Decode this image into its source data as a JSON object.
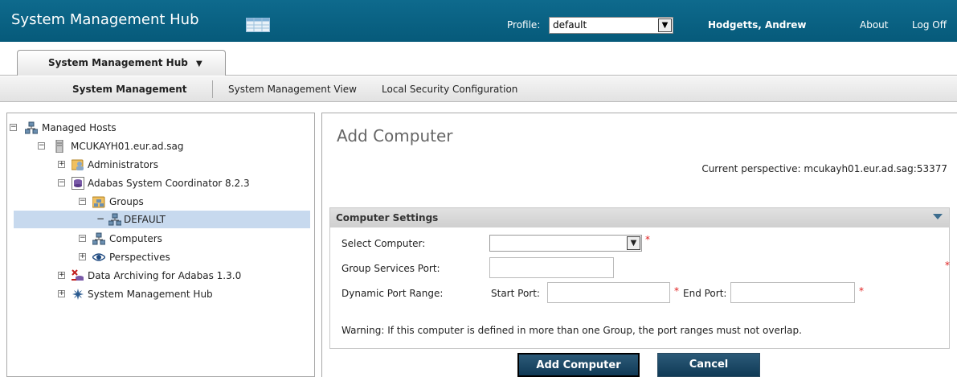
{
  "header": {
    "app_title": "System Management Hub",
    "profile_label": "Profile:",
    "profile_value": "default",
    "user_name": "Hodgetts, Andrew",
    "about": "About",
    "logoff": "Log Off"
  },
  "tabs": {
    "hub_tab": "System Management Hub"
  },
  "subnav": {
    "items": [
      "System Management",
      "System Management View",
      "Local Security Configuration"
    ]
  },
  "tree": {
    "nodes": [
      {
        "label": "Managed Hosts",
        "expander": "−",
        "icon": "network-icon"
      },
      {
        "label": "MCUKAYH01.eur.ad.sag",
        "expander": "−",
        "icon": "server-icon"
      },
      {
        "label": "Administrators",
        "expander": "+",
        "icon": "users-icon"
      },
      {
        "label": "Adabas System Coordinator 8.2.3",
        "expander": "−",
        "icon": "database-icon"
      },
      {
        "label": "Groups",
        "expander": "−",
        "icon": "group-folder-icon"
      },
      {
        "label": "DEFAULT",
        "expander": "−",
        "icon": "network-icon"
      },
      {
        "label": "Computers",
        "expander": "−",
        "icon": "network-icon"
      },
      {
        "label": "Perspectives",
        "expander": "+",
        "icon": "eye-icon"
      },
      {
        "label": "Data Archiving for Adabas 1.3.0",
        "expander": "+",
        "icon": "archive-icon"
      },
      {
        "label": "System Management Hub",
        "expander": "+",
        "icon": "hub-icon"
      }
    ]
  },
  "content": {
    "title": "Add Computer",
    "perspective": "Current perspective: mcukayh01.eur.ad.sag:53377",
    "section_title": "Computer Settings",
    "select_computer_label": "Select Computer:",
    "group_services_port_label": "Group Services Port:",
    "dynamic_port_range_label": "Dynamic Port Range:",
    "start_port_label": "Start Port:",
    "end_port_label": "End Port:",
    "required_mark": "*",
    "warning": "Warning: If this computer is defined in more than one Group, the port ranges must not overlap.",
    "add_button": "Add Computer",
    "cancel_button": "Cancel"
  },
  "colors": {
    "header_bg": "#0e6a8d",
    "selected_row": "#c7d9ee",
    "button_bg": "#1e4a66",
    "required": "#e02020"
  }
}
